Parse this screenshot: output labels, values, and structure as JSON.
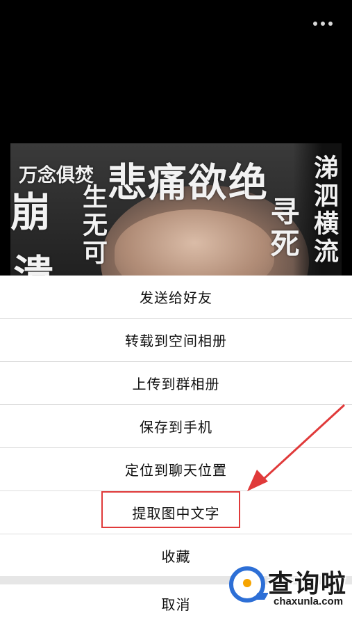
{
  "header": {
    "more_icon": "ellipsis-icon"
  },
  "image": {
    "texts": {
      "t1": "万念俱焚",
      "t2": "悲痛欲绝",
      "t3": "崩",
      "t4": "溃",
      "t5": "生无可",
      "t6": "寻死",
      "t7": "涕泗横流"
    }
  },
  "menu": {
    "items": [
      {
        "label": "发送给好友"
      },
      {
        "label": "转载到空间相册"
      },
      {
        "label": "上传到群相册"
      },
      {
        "label": "保存到手机"
      },
      {
        "label": "定位到聊天位置"
      },
      {
        "label": "提取图中文字"
      },
      {
        "label": "收藏"
      }
    ],
    "cancel": "取消"
  },
  "annotation": {
    "color": "#e03a3a",
    "highlighted_item": "提取图中文字"
  },
  "watermark": {
    "title": "查询啦",
    "url": "chaxunla.com"
  }
}
